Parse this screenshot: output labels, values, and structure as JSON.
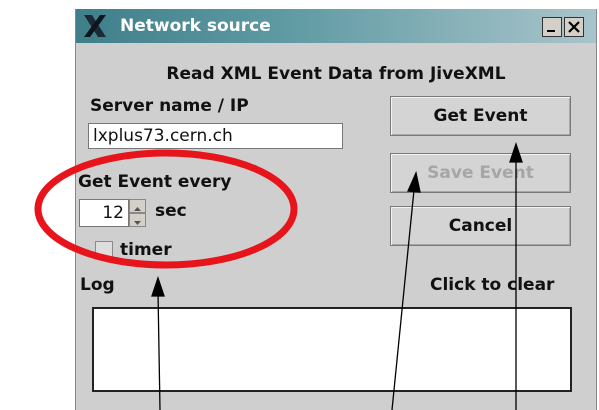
{
  "window": {
    "title": "Network source",
    "min_label": "_",
    "close_label": "X"
  },
  "main": {
    "heading": "Read XML Event Data from JiveXML",
    "server_label": "Server name / IP",
    "server_value": "lxplus73.cern.ch",
    "get_event_every_label": "Get Event every",
    "interval_value": "12",
    "interval_unit": "sec",
    "timer_label": "timer",
    "timer_checked": false,
    "log_label": "Log",
    "clear_label": "Click to clear"
  },
  "buttons": {
    "get_event": "Get Event",
    "save_event": "Save Event",
    "cancel": "Cancel"
  },
  "annotation": {
    "ellipse_color": "#e8141c",
    "arrow_color": "#000000"
  }
}
